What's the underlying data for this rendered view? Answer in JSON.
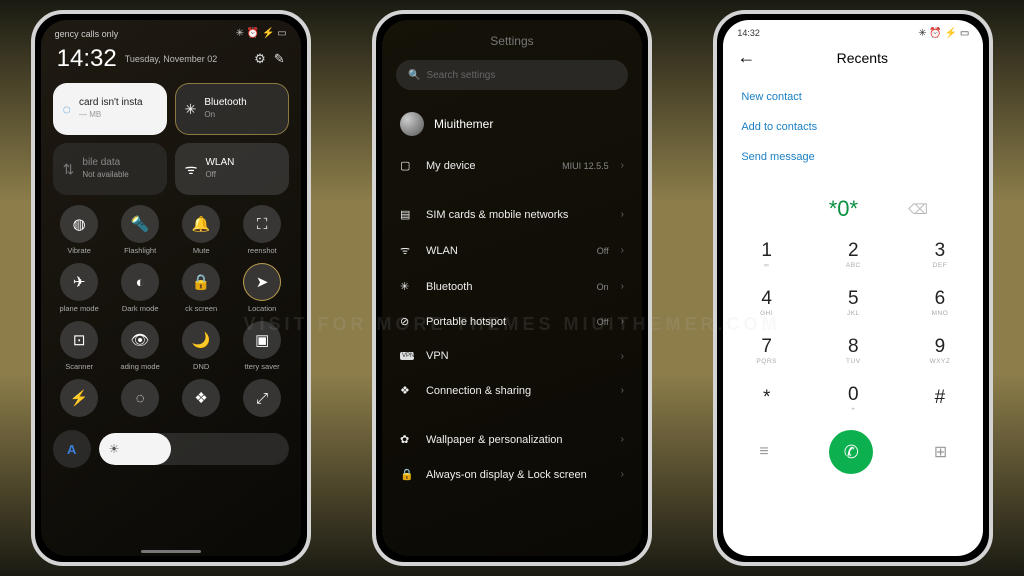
{
  "watermark": "VISIT FOR MORE THEMES   MIUITHEMER.COM",
  "p1": {
    "status_left": "gency calls only",
    "time": "14:32",
    "date": "Tuesday, November 02",
    "card_tile": {
      "line1": "card isn't insta",
      "line2": "— MB"
    },
    "bt_tile": {
      "label": "Bluetooth",
      "sub": "On"
    },
    "data_tile": {
      "label": "bile data",
      "sub": "Not available"
    },
    "wlan_tile": {
      "label": "WLAN",
      "sub": "Off"
    },
    "tgls": [
      {
        "label": "Vibrate",
        "ico": "◍"
      },
      {
        "label": "Flashlight",
        "ico": "🔦"
      },
      {
        "label": "Mute",
        "ico": "🔔"
      },
      {
        "label": "reenshot",
        "ico": "⛶"
      },
      {
        "label": "plane mode",
        "ico": "✈"
      },
      {
        "label": "Dark mode",
        "ico": "◐"
      },
      {
        "label": "ck screen",
        "ico": "🔒"
      },
      {
        "label": "Location",
        "ico": "➤"
      },
      {
        "label": "Scanner",
        "ico": "⊡"
      },
      {
        "label": "ading mode",
        "ico": "👁"
      },
      {
        "label": "DND",
        "ico": "🌙"
      },
      {
        "label": "ttery saver",
        "ico": "▣"
      },
      {
        "label": "",
        "ico": "⚡"
      },
      {
        "label": "",
        "ico": "◌"
      },
      {
        "label": "",
        "ico": "❖"
      },
      {
        "label": "",
        "ico": "⤢"
      }
    ],
    "auto": "A"
  },
  "p2": {
    "title": "Settings",
    "search": "Search settings",
    "account": "Miuithemer",
    "items": [
      {
        "ico": "▢",
        "label": "My device",
        "val": "MIUI 12.5.5"
      },
      {
        "ico": "▤",
        "label": "SIM cards & mobile networks",
        "val": ""
      },
      {
        "ico": "ᯤ",
        "label": "WLAN",
        "val": "Off"
      },
      {
        "ico": "✳",
        "label": "Bluetooth",
        "val": "On"
      },
      {
        "ico": "⊘",
        "label": "Portable hotspot",
        "val": "Off"
      },
      {
        "ico": "VPN",
        "label": "VPN",
        "val": ""
      },
      {
        "ico": "❖",
        "label": "Connection & sharing",
        "val": ""
      },
      {
        "ico": "✿",
        "label": "Wallpaper & personalization",
        "val": ""
      },
      {
        "ico": "🔒",
        "label": "Always-on display & Lock screen",
        "val": ""
      }
    ]
  },
  "p3": {
    "time": "14:32",
    "title": "Recents",
    "links": [
      "New contact",
      "Add to contacts",
      "Send message"
    ],
    "entered": "*0*",
    "keys": [
      {
        "d": "1",
        "l": "∞"
      },
      {
        "d": "2",
        "l": "ABC"
      },
      {
        "d": "3",
        "l": "DEF"
      },
      {
        "d": "4",
        "l": "GHI"
      },
      {
        "d": "5",
        "l": "JKL"
      },
      {
        "d": "6",
        "l": "MNO"
      },
      {
        "d": "7",
        "l": "PQRS"
      },
      {
        "d": "8",
        "l": "TUV"
      },
      {
        "d": "9",
        "l": "WXYZ"
      },
      {
        "d": "*",
        "l": ""
      },
      {
        "d": "0",
        "l": "+"
      },
      {
        "d": "#",
        "l": ""
      }
    ]
  }
}
